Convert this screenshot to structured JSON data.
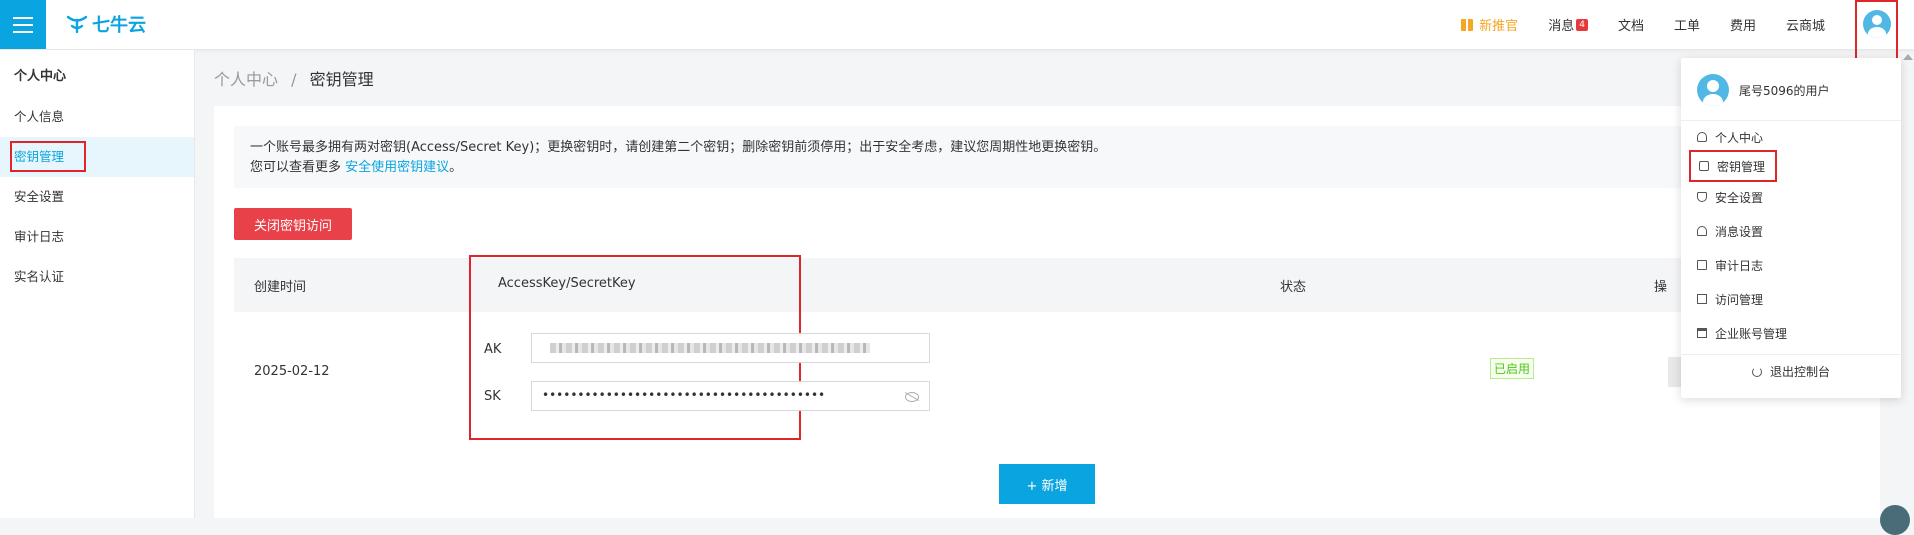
{
  "header": {
    "logo_text": "七牛云",
    "nav": {
      "promo": "新推官",
      "messages": "消息",
      "messages_badge": "4",
      "docs": "文档",
      "tickets": "工单",
      "billing": "费用",
      "marketplace": "云商城"
    }
  },
  "sidebar": {
    "title": "个人中心",
    "items": [
      {
        "label": "个人信息"
      },
      {
        "label": "密钥管理"
      },
      {
        "label": "安全设置"
      },
      {
        "label": "审计日志"
      },
      {
        "label": "实名认证"
      }
    ]
  },
  "breadcrumb": {
    "parent": "个人中心",
    "separator": "/",
    "current": "密钥管理"
  },
  "notice": {
    "line1": "一个账号最多拥有两对密钥(Access/Secret Key)；更换密钥时，请创建第二个密钥；删除密钥前须停用；出于安全考虑，建议您周期性地更换密钥。",
    "line2_prefix": "您可以查看更多 ",
    "line2_link": "安全使用密钥建议",
    "line2_suffix": "。"
  },
  "actions": {
    "close_access": "关闭密钥访问",
    "add": "+ 新增"
  },
  "table": {
    "headers": {
      "created": "创建时间",
      "keys": "AccessKey/SecretKey",
      "status": "状态",
      "ops": "操"
    },
    "rows": [
      {
        "created": "2025-02-12",
        "ak_label": "AK",
        "sk_label": "SK",
        "sk_masked": "••••••••••••••••••••••••••••••••••••••••",
        "status": "已启用"
      }
    ]
  },
  "dropdown": {
    "username": "尾号5096的用户",
    "items": [
      {
        "label": "个人中心",
        "icon": "person-icon"
      },
      {
        "label": "密钥管理",
        "icon": "lock-icon"
      },
      {
        "label": "安全设置",
        "icon": "shield-icon"
      },
      {
        "label": "消息设置",
        "icon": "bell-icon"
      },
      {
        "label": "审计日志",
        "icon": "monitor-icon"
      },
      {
        "label": "访问管理",
        "icon": "access-icon"
      },
      {
        "label": "企业账号管理",
        "icon": "building-icon"
      }
    ],
    "logout": "退出控制台"
  },
  "colors": {
    "brand": "#0aa5e0",
    "danger": "#e8414a",
    "highlight_box": "#e0242b",
    "status_green": "#52c41a"
  }
}
